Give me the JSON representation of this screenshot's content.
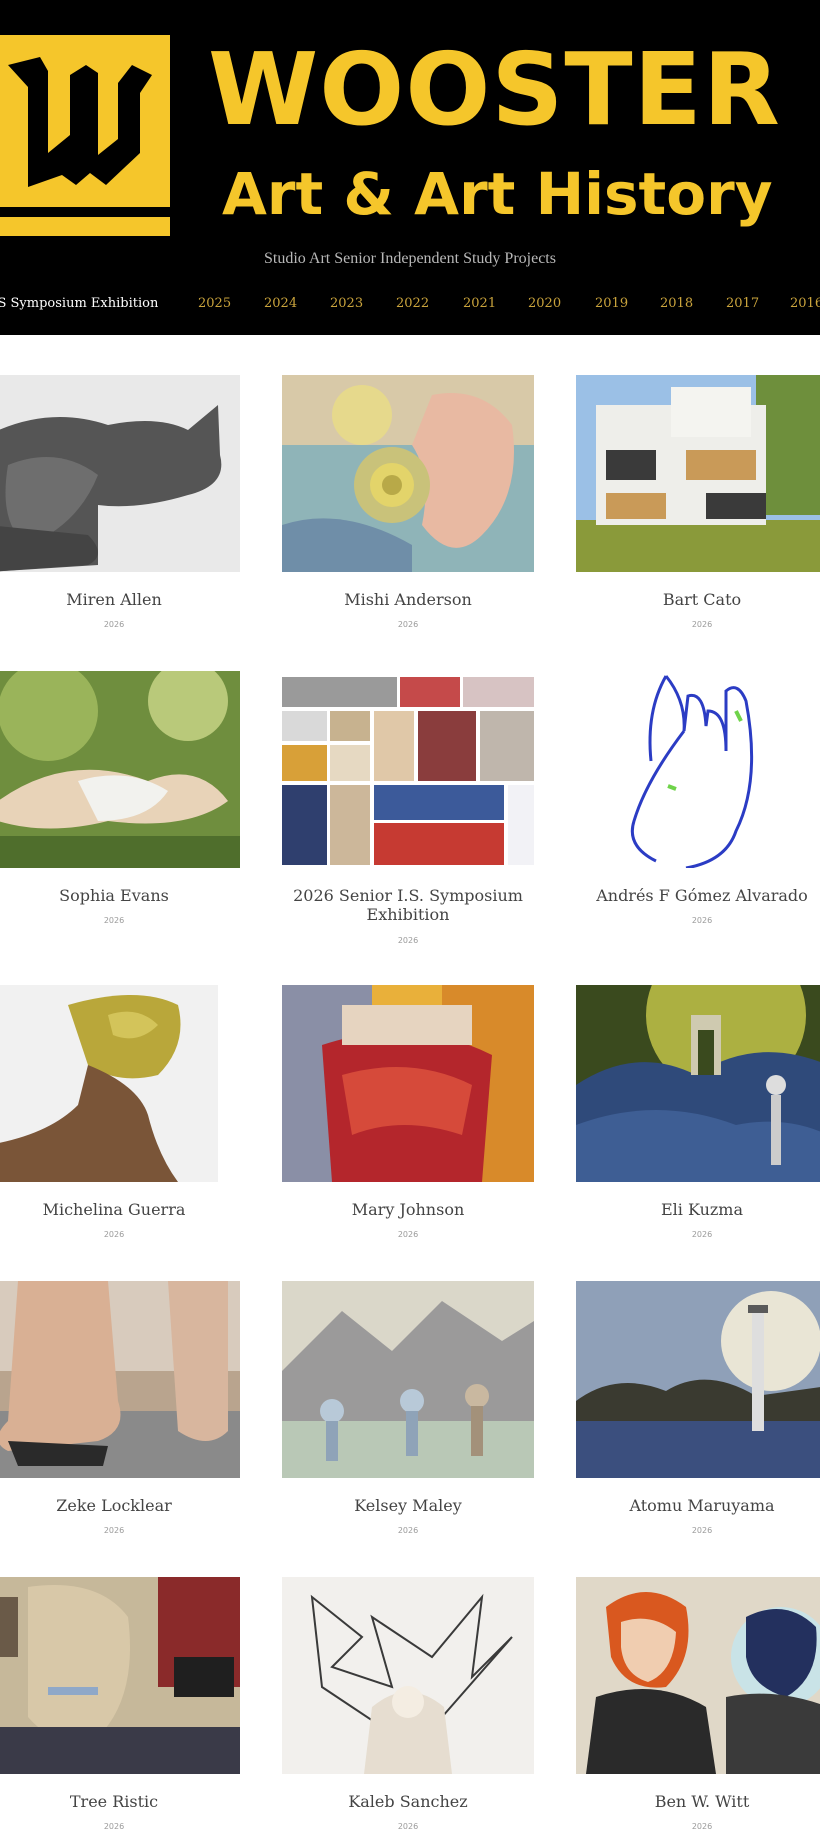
{
  "brand": {
    "wordmark": "WOOSTER",
    "subtitle": "Art & Art History",
    "tagline": "Studio Art Senior Independent Study Projects",
    "accent_color": "#f5c62b",
    "logo_icon": "gothic-w-logo-icon"
  },
  "nav": {
    "first_label": "r IS Symposium Exhibition",
    "years": [
      "2025",
      "2024",
      "2023",
      "2022",
      "2021",
      "2020",
      "2019",
      "2018",
      "2017",
      "2016"
    ]
  },
  "cards": [
    {
      "name": "Miren Allen",
      "year": "2026",
      "image": "ceramic-cat-sculpture"
    },
    {
      "name": "Mishi Anderson",
      "year": "2026",
      "image": "ram-and-face-painting"
    },
    {
      "name": "Bart Cato",
      "year": "2026",
      "image": "modern-white-building"
    },
    {
      "name": "Sophia Evans",
      "year": "2026",
      "image": "reclining-figure-painting"
    },
    {
      "name": "2026 Senior I.S. Symposium Exhibition",
      "year": "2026",
      "image": "exhibition-collage"
    },
    {
      "name": "Andrés F Gómez Alvarado",
      "year": "2026",
      "image": "blue-hand-drawing"
    },
    {
      "name": "Michelina Guerra",
      "year": "2026",
      "image": "clay-leaf-sculpture"
    },
    {
      "name": "Mary Johnson",
      "year": "2026",
      "image": "red-fabric-painting"
    },
    {
      "name": "Eli Kuzma",
      "year": "2026",
      "image": "blue-dunes-landscape"
    },
    {
      "name": "Zeke Locklear",
      "year": "2026",
      "image": "foot-sculpture"
    },
    {
      "name": "Kelsey Maley",
      "year": "2026",
      "image": "runners-watercolor"
    },
    {
      "name": "Atomu Maruyama",
      "year": "2026",
      "image": "lighthouse-render"
    },
    {
      "name": "Tree Ristic",
      "year": "2026",
      "image": "face-collage"
    },
    {
      "name": "Kaleb Sanchez",
      "year": "2026",
      "image": "wire-sculpture"
    },
    {
      "name": "Ben W. Witt",
      "year": "2026",
      "image": "comic-illustration"
    }
  ]
}
